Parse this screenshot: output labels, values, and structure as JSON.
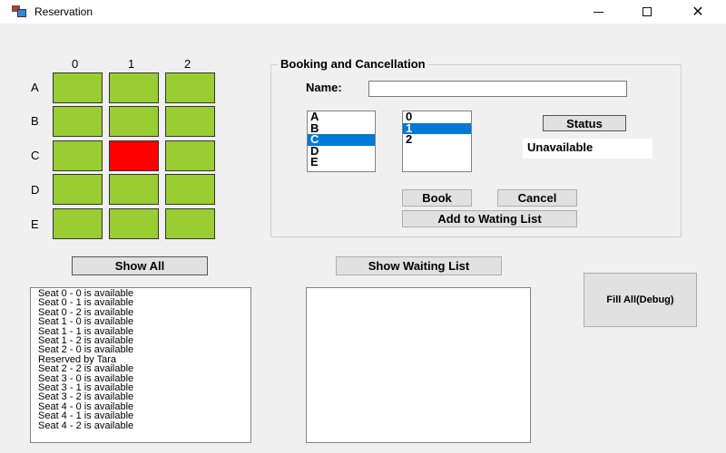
{
  "window": {
    "title": "Reservation",
    "min_icon": "minimize-icon",
    "max_icon": "maximize-icon",
    "close_icon": "close-icon"
  },
  "seat_grid": {
    "columns": [
      "0",
      "1",
      "2"
    ],
    "rows": [
      "A",
      "B",
      "C",
      "D",
      "E"
    ],
    "available_color": "#9acd32",
    "reserved_color": "#ff0000",
    "reserved_seat": "C1"
  },
  "booking": {
    "group_title": "Booking and Cancellation",
    "name_label": "Name:",
    "name_value": "",
    "row_options": [
      "A",
      "B",
      "C",
      "D",
      "E"
    ],
    "row_selected": "C",
    "col_options": [
      "0",
      "1",
      "2"
    ],
    "col_selected": "1",
    "status_button": "Status",
    "status_text": "Unavailable",
    "book_button": "Book",
    "cancel_button": "Cancel",
    "waiting_button": "Add to Wating List"
  },
  "controls": {
    "show_all": "Show All",
    "show_waiting": "Show Waiting List",
    "fill_all": "Fill All(Debug)"
  },
  "output": {
    "lines": [
      "Seat 0 - 0 is available",
      "Seat 0 - 1 is available",
      "Seat 0 - 2 is available",
      "Seat 1 - 0 is available",
      "Seat 1 - 1 is available",
      "Seat 1 - 2 is available",
      "Seat 2 - 0 is available",
      "Reserved by Tara",
      "Seat 2 - 2 is available",
      "Seat 3 - 0 is available",
      "Seat 3 - 1 is available",
      "Seat 3 - 2 is available",
      "Seat 4 - 0 is available",
      "Seat 4 - 1 is available",
      "Seat 4 - 2 is available"
    ]
  },
  "waiting_list": {
    "items": []
  }
}
